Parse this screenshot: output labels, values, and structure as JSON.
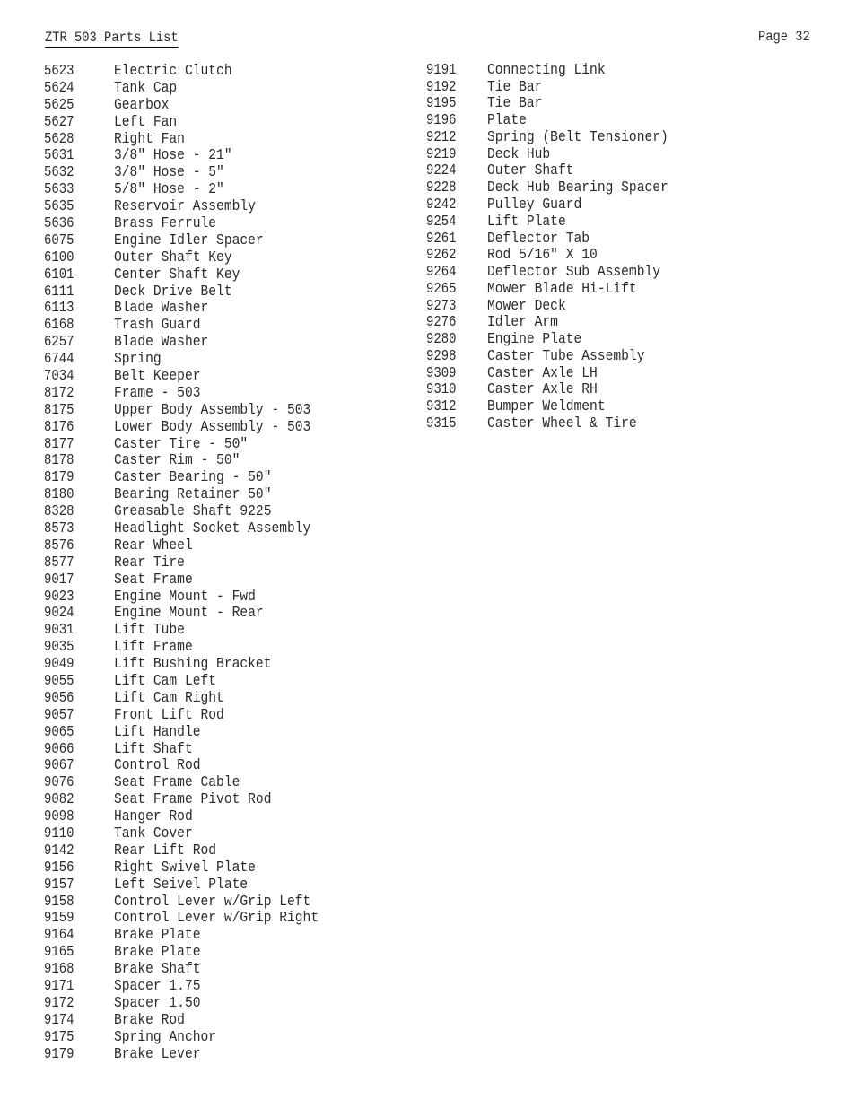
{
  "header": {
    "title": "ZTR 503 Parts List",
    "page": "Page 32"
  },
  "left_column": [
    {
      "part": "5623",
      "description": "Electric Clutch"
    },
    {
      "part": "5624",
      "description": "Tank Cap"
    },
    {
      "part": "5625",
      "description": "Gearbox"
    },
    {
      "part": "5627",
      "description": "Left Fan"
    },
    {
      "part": "5628",
      "description": "Right Fan"
    },
    {
      "part": "5631",
      "description": "3/8\" Hose - 21\""
    },
    {
      "part": "5632",
      "description": "3/8\" Hose - 5\""
    },
    {
      "part": "5633",
      "description": "5/8\" Hose - 2\""
    },
    {
      "part": "5635",
      "description": "Reservoir Assembly"
    },
    {
      "part": "5636",
      "description": "Brass Ferrule"
    },
    {
      "part": "6075",
      "description": "Engine Idler Spacer"
    },
    {
      "part": "6100",
      "description": "Outer Shaft Key"
    },
    {
      "part": "6101",
      "description": "Center Shaft Key"
    },
    {
      "part": "6111",
      "description": "Deck Drive Belt"
    },
    {
      "part": "6113",
      "description": "Blade Washer"
    },
    {
      "part": "6168",
      "description": "Trash Guard"
    },
    {
      "part": "6257",
      "description": "Blade Washer"
    },
    {
      "part": "6744",
      "description": "Spring"
    },
    {
      "part": "7034",
      "description": "Belt Keeper"
    },
    {
      "part": "8172",
      "description": "Frame - 503"
    },
    {
      "part": "8175",
      "description": "Upper Body Assembly - 503"
    },
    {
      "part": "8176",
      "description": "Lower Body Assembly - 503"
    },
    {
      "part": "8177",
      "description": "Caster Tire - 50\""
    },
    {
      "part": "8178",
      "description": "Caster Rim - 50\""
    },
    {
      "part": "8179",
      "description": "Caster Bearing - 50\""
    },
    {
      "part": "8180",
      "description": "Bearing Retainer 50\""
    },
    {
      "part": "8328",
      "description": "Greasable Shaft 9225"
    },
    {
      "part": "8573",
      "description": "Headlight Socket Assembly"
    },
    {
      "part": "8576",
      "description": "Rear Wheel"
    },
    {
      "part": "8577",
      "description": "Rear Tire"
    },
    {
      "part": "9017",
      "description": "Seat Frame"
    },
    {
      "part": "9023",
      "description": "Engine Mount - Fwd"
    },
    {
      "part": "9024",
      "description": "Engine Mount - Rear"
    },
    {
      "part": "9031",
      "description": "Lift Tube"
    },
    {
      "part": "9035",
      "description": "Lift Frame"
    },
    {
      "part": "9049",
      "description": "Lift Bushing Bracket"
    },
    {
      "part": "9055",
      "description": "Lift Cam Left"
    },
    {
      "part": "9056",
      "description": "Lift Cam Right"
    },
    {
      "part": "9057",
      "description": "Front Lift Rod"
    },
    {
      "part": "9065",
      "description": "Lift Handle"
    },
    {
      "part": "9066",
      "description": "Lift Shaft"
    },
    {
      "part": "9067",
      "description": "Control Rod"
    },
    {
      "part": "9076",
      "description": "Seat Frame Cable"
    },
    {
      "part": "9082",
      "description": "Seat Frame Pivot Rod"
    },
    {
      "part": "9098",
      "description": "Hanger Rod"
    },
    {
      "part": "9110",
      "description": "Tank Cover"
    },
    {
      "part": "9142",
      "description": "Rear Lift Rod"
    },
    {
      "part": "9156",
      "description": "Right Swivel Plate"
    },
    {
      "part": "9157",
      "description": "Left Seivel Plate"
    },
    {
      "part": "9158",
      "description": "Control Lever w/Grip Left"
    },
    {
      "part": "9159",
      "description": "Control Lever w/Grip Right"
    },
    {
      "part": "9164",
      "description": "Brake Plate"
    },
    {
      "part": "9165",
      "description": "Brake Plate"
    },
    {
      "part": "9168",
      "description": "Brake Shaft"
    },
    {
      "part": "9171",
      "description": "Spacer 1.75"
    },
    {
      "part": "9172",
      "description": "Spacer 1.50"
    },
    {
      "part": "9174",
      "description": "Brake Rod"
    },
    {
      "part": "9175",
      "description": "Spring Anchor"
    },
    {
      "part": "9179",
      "description": "Brake Lever"
    }
  ],
  "right_column": [
    {
      "part": "9191",
      "description": "Connecting Link"
    },
    {
      "part": "9192",
      "description": "Tie Bar"
    },
    {
      "part": "9195",
      "description": "Tie Bar"
    },
    {
      "part": "9196",
      "description": "Plate"
    },
    {
      "part": "9212",
      "description": "Spring (Belt Tensioner)"
    },
    {
      "part": "9219",
      "description": "Deck Hub"
    },
    {
      "part": "9224",
      "description": "Outer Shaft"
    },
    {
      "part": "9228",
      "description": "Deck Hub Bearing Spacer"
    },
    {
      "part": "9242",
      "description": "Pulley Guard"
    },
    {
      "part": "9254",
      "description": "Lift Plate"
    },
    {
      "part": "9261",
      "description": "Deflector Tab"
    },
    {
      "part": "9262",
      "description": "Rod 5/16\" X 10"
    },
    {
      "part": "9264",
      "description": "Deflector Sub Assembly"
    },
    {
      "part": "9265",
      "description": "Mower Blade Hi-Lift"
    },
    {
      "part": "9273",
      "description": "Mower Deck"
    },
    {
      "part": "9276",
      "description": "Idler Arm"
    },
    {
      "part": "9280",
      "description": "Engine Plate"
    },
    {
      "part": "9298",
      "description": "Caster Tube Assembly"
    },
    {
      "part": "9309",
      "description": "Caster Axle LH"
    },
    {
      "part": "9310",
      "description": "Caster Axle RH"
    },
    {
      "part": "9312",
      "description": "Bumper Weldment"
    },
    {
      "part": "9315",
      "description": "Caster Wheel & Tire"
    }
  ]
}
